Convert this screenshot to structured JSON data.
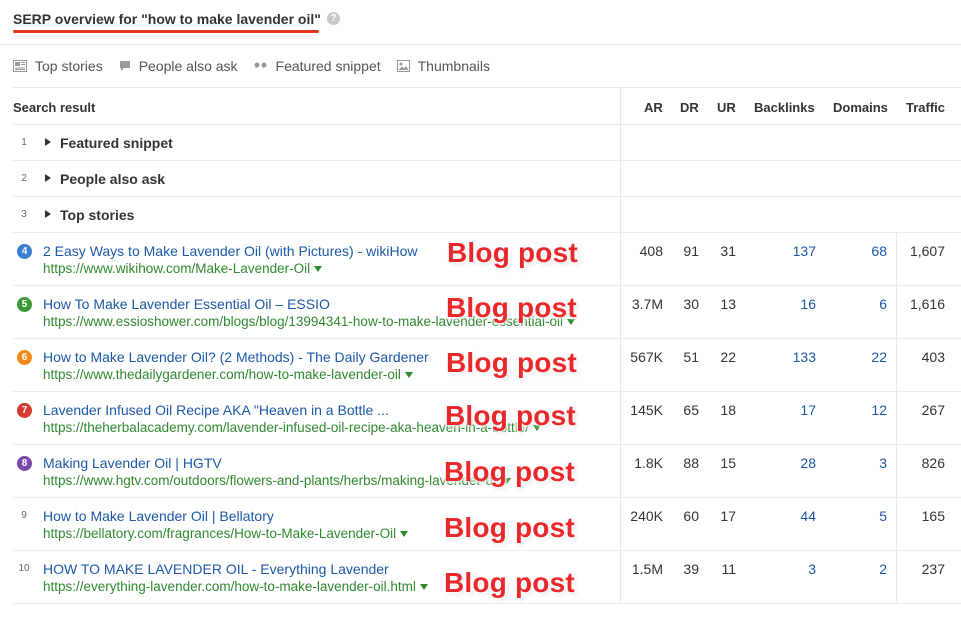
{
  "header": {
    "title": "SERP overview for \"how to make lavender oil\"",
    "help_icon": "question-icon"
  },
  "features": [
    {
      "label": "Top stories",
      "icon": "newspaper-icon"
    },
    {
      "label": "People also ask",
      "icon": "speech-bubble-icon"
    },
    {
      "label": "Featured snippet",
      "icon": "quote-icon"
    },
    {
      "label": "Thumbnails",
      "icon": "image-icon"
    }
  ],
  "table": {
    "columns": {
      "search_result": "Search result",
      "ar": "AR",
      "dr": "DR",
      "ur": "UR",
      "backlinks": "Backlinks",
      "domains": "Domains",
      "traffic": "Traffic"
    },
    "sections": [
      {
        "num": "1",
        "label": "Featured snippet"
      },
      {
        "num": "2",
        "label": "People also ask"
      },
      {
        "num": "3",
        "label": "Top stories"
      }
    ],
    "results": [
      {
        "num": "4",
        "badge_color": "#3a7fd1",
        "title": "2 Easy Ways to Make Lavender Oil (with Pictures) - wikiHow",
        "url": "https://www.wikihow.com/Make-Lavender-Oil",
        "ar": "408",
        "dr": "91",
        "ur": "31",
        "backlinks": "137",
        "domains": "68",
        "traffic": "1,607",
        "annotation": "Blog post"
      },
      {
        "num": "5",
        "badge_color": "#3a9a3a",
        "title": "How To Make Lavender Essential Oil – ESSIO",
        "url": "https://www.essioshower.com/blogs/blog/13994341-how-to-make-lavender-essential-oil",
        "ar": "3.7M",
        "dr": "30",
        "ur": "13",
        "backlinks": "16",
        "domains": "6",
        "traffic": "1,616",
        "annotation": "Blog post"
      },
      {
        "num": "6",
        "badge_color": "#f08a1c",
        "title": "How to Make Lavender Oil? (2 Methods) - The Daily Gardener",
        "url": "https://www.thedailygardener.com/how-to-make-lavender-oil",
        "ar": "567K",
        "dr": "51",
        "ur": "22",
        "backlinks": "133",
        "domains": "22",
        "traffic": "403",
        "annotation": "Blog post"
      },
      {
        "num": "7",
        "badge_color": "#d63a32",
        "title": "Lavender Infused Oil Recipe AKA \"Heaven in a Bottle ...",
        "url": "https://theherbalacademy.com/lavender-infused-oil-recipe-aka-heaven-in-a-bottle/",
        "ar": "145K",
        "dr": "65",
        "ur": "18",
        "backlinks": "17",
        "domains": "12",
        "traffic": "267",
        "annotation": "Blog post"
      },
      {
        "num": "8",
        "badge_color": "#7a4aa8",
        "title": "Making Lavender Oil | HGTV",
        "url": "https://www.hgtv.com/outdoors/flowers-and-plants/herbs/making-lavender-oil",
        "ar": "1.8K",
        "dr": "88",
        "ur": "15",
        "backlinks": "28",
        "domains": "3",
        "traffic": "826",
        "annotation": "Blog post"
      },
      {
        "num": "9",
        "badge_color": "",
        "title": "How to Make Lavender Oil | Bellatory",
        "url": "https://bellatory.com/fragrances/How-to-Make-Lavender-Oil",
        "ar": "240K",
        "dr": "60",
        "ur": "17",
        "backlinks": "44",
        "domains": "5",
        "traffic": "165",
        "annotation": "Blog post"
      },
      {
        "num": "10",
        "badge_color": "",
        "title": "HOW TO MAKE LAVENDER OIL - Everything Lavender",
        "url": "https://everything-lavender.com/how-to-make-lavender-oil.html",
        "ar": "1.5M",
        "dr": "39",
        "ur": "11",
        "backlinks": "3",
        "domains": "2",
        "traffic": "237",
        "annotation": "Blog post"
      }
    ]
  }
}
